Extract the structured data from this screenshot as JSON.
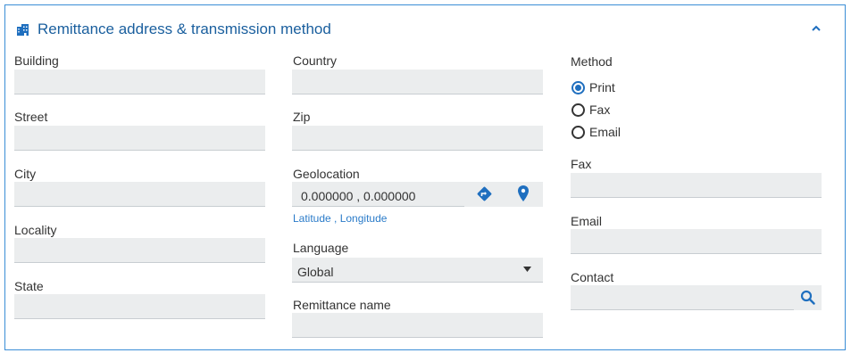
{
  "section": {
    "title": "Remittance address & transmission method"
  },
  "icons": {
    "header": "building-icon",
    "collapse": "chevron-up-icon",
    "directions": "directions-icon",
    "map_pin": "map-pin-icon",
    "search": "search-icon",
    "dropdown": "caret-down-icon"
  },
  "colors": {
    "accent": "#1f6fbf",
    "field_bg": "#ebedee",
    "border": "#3a8ed6"
  },
  "left_column": {
    "building_label": "Building",
    "street_label": "Street",
    "city_label": "City",
    "locality_label": "Locality",
    "state_label": "State"
  },
  "middle_column": {
    "country_label": "Country",
    "zip_label": "Zip",
    "geolocation_label": "Geolocation",
    "geolocation_value": "0.000000 ,  0.000000",
    "geolocation_hint": "Latitude , Longitude",
    "language_label": "Language",
    "language_value": "Global",
    "remittance_name_label": "Remittance name"
  },
  "right_column": {
    "method_label": "Method",
    "methods": [
      {
        "label": "Print",
        "selected": true
      },
      {
        "label": "Fax",
        "selected": false
      },
      {
        "label": "Email",
        "selected": false
      }
    ],
    "fax_label": "Fax",
    "email_label": "Email",
    "contact_label": "Contact"
  }
}
